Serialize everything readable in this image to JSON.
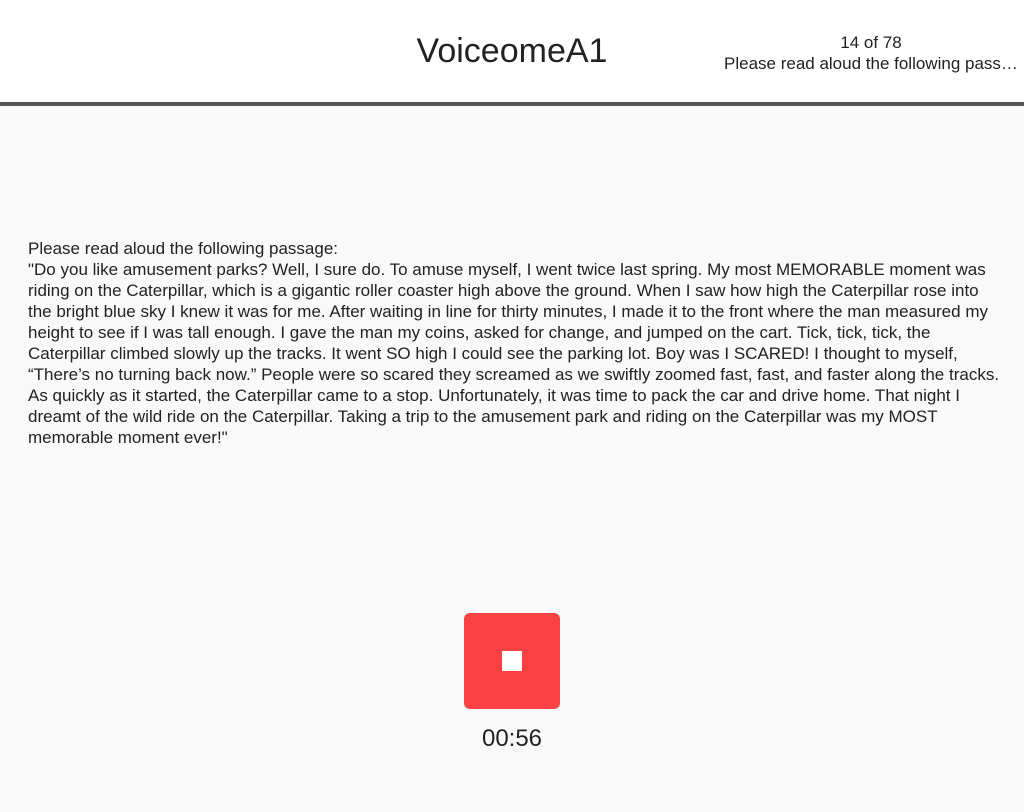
{
  "header": {
    "title": "VoiceomeA1",
    "progress": "14 of 78",
    "task_preview": "Please read aloud the following passage:"
  },
  "passage": {
    "instruction": "Please read aloud the following passage:",
    "text": "\"Do you like amusement parks? Well, I sure do. To amuse myself, I went twice last spring. My most MEMORABLE moment was riding on the Caterpillar, which is a gigantic roller coaster high above the ground. When I saw how high the Caterpillar rose into the bright blue sky I knew it was for me. After waiting in line for thirty minutes, I made it to the front where the man measured my height to see if I was tall enough. I gave the man my coins, asked for change, and jumped on the cart. Tick, tick, tick, the Caterpillar climbed slowly up the tracks. It went SO high I could see the parking lot. Boy was I SCARED! I thought to myself, “There’s no turning back now.” People were so scared they screamed as we swiftly zoomed fast, fast, and faster along the tracks. As quickly as it started, the Caterpillar came to a stop. Unfortunately, it was time to pack the car and drive home. That night I dreamt of the wild ride on the Caterpillar. Taking a trip to the amusement park and riding on the Caterpillar was my MOST memorable moment ever!\""
  },
  "recorder": {
    "stop_icon": "stop-icon",
    "button_color": "#f94144",
    "elapsed": "00:56"
  }
}
